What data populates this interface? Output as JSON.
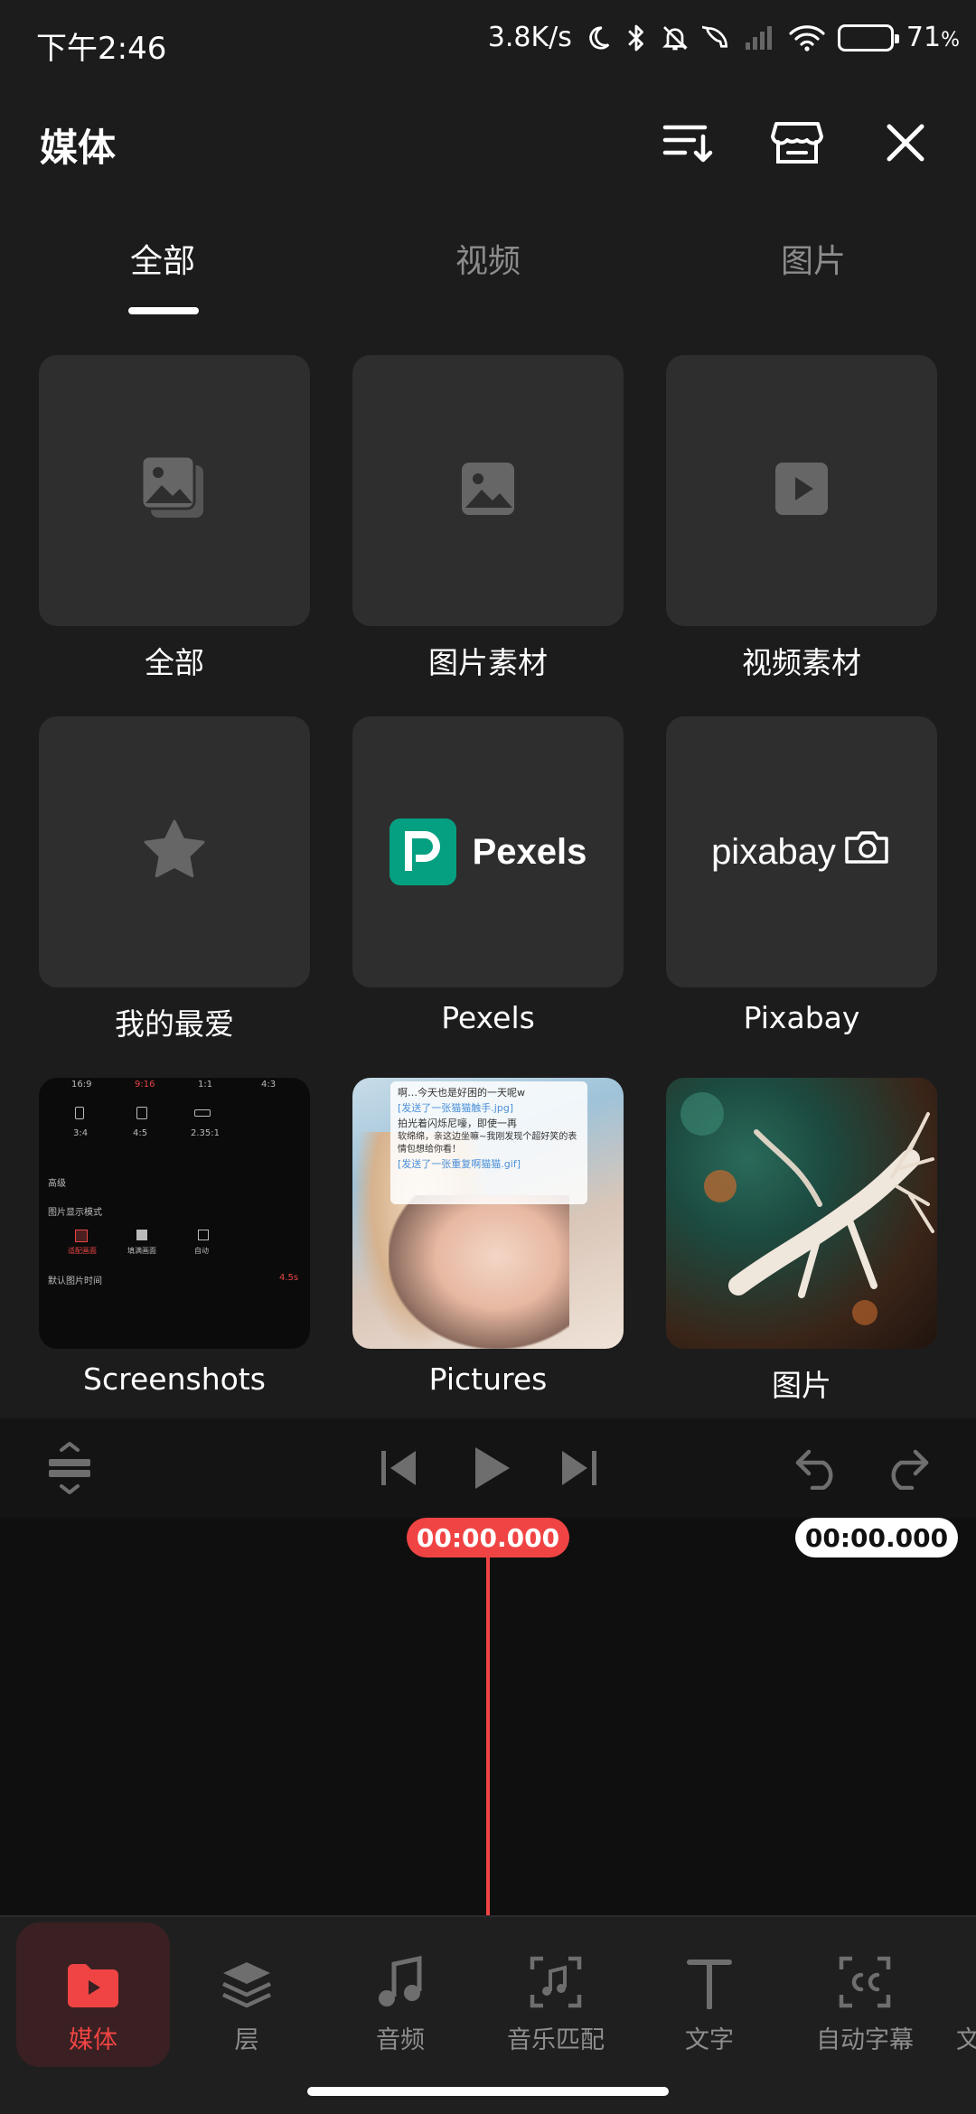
{
  "status": {
    "time": "下午2:46",
    "net_speed": "3.8K/s",
    "battery": "71",
    "battery_unit": "%",
    "battery_level": 0.71
  },
  "header": {
    "title": "媒体",
    "icons": [
      "sort-icon",
      "store-icon",
      "close-icon"
    ]
  },
  "tabs": [
    {
      "label": "全部",
      "active": true
    },
    {
      "label": "视频",
      "active": false
    },
    {
      "label": "图片",
      "active": false
    }
  ],
  "albums": [
    {
      "label": "全部",
      "icon": "gallery-stack-icon"
    },
    {
      "label": "图片素材",
      "icon": "image-icon"
    },
    {
      "label": "视频素材",
      "icon": "video-play-icon"
    },
    {
      "label": "我的最爱",
      "icon": "star-icon"
    },
    {
      "label": "Pexels",
      "logo_text": "Pexels",
      "logo_color": "#05a081"
    },
    {
      "label": "Pixabay",
      "logo_text": "pixabay"
    },
    {
      "label": "Screenshots"
    },
    {
      "label": "Pictures"
    },
    {
      "label": "图片"
    }
  ],
  "screenshot_thumb": {
    "ratios": [
      "16:9",
      "9:16",
      "1:1",
      "4:3"
    ],
    "ratios2": [
      "3:4",
      "4:5",
      "2.35:1"
    ],
    "advanced": "高级",
    "mode_title": "图片显示模式",
    "modes": [
      "适配画面",
      "填满画面",
      "自动"
    ],
    "default_time": "默认图片时间",
    "default_time_value": "4.5s"
  },
  "pictures_thumb": {
    "lines": [
      "啊…今天也是好困的一天呢w",
      "[发送了一张猫猫触手.jpg]",
      "拍光着闪烁尼嚎，即使一再",
      "软绵绵，亲这边坐嘛~我刚发现个超好笑的表情包想给你看！",
      "[发送了一张重复啊猫猫.gif]"
    ]
  },
  "editor": {
    "current_time": "00:00.000",
    "total_time": "00:00.000"
  },
  "toolbar": [
    {
      "label": "媒体",
      "icon": "media-folder-icon",
      "active": true
    },
    {
      "label": "层",
      "icon": "layers-icon",
      "active": false
    },
    {
      "label": "音频",
      "icon": "music-note-icon",
      "active": false
    },
    {
      "label": "音乐匹配",
      "icon": "music-match-icon",
      "active": false
    },
    {
      "label": "文字",
      "icon": "text-icon",
      "active": false
    },
    {
      "label": "自动字幕",
      "icon": "captions-icon",
      "active": false
    },
    {
      "label": "文",
      "icon": "text-more-icon",
      "active": false
    }
  ],
  "colors": {
    "accent": "#f04444",
    "background": "#1c1c1c",
    "tile": "#2e2e2e"
  }
}
